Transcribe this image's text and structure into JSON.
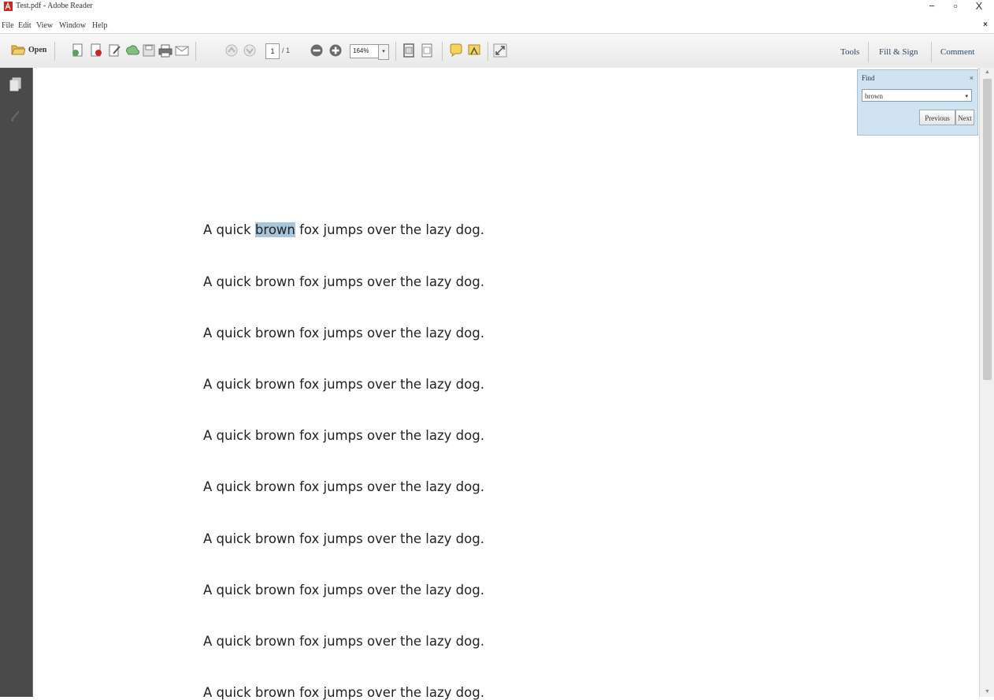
{
  "window": {
    "title": "Test.pdf - Adobe Reader",
    "minimize": "−",
    "maximize": "▫",
    "close": "X"
  },
  "menu": {
    "items": [
      "File",
      "Edit",
      "View",
      "Window",
      "Help"
    ],
    "close": "×"
  },
  "toolbar": {
    "open_label": "Open",
    "page_current": "1",
    "page_total": "/ 1",
    "zoom": "164%",
    "zoom_arrow": "▾"
  },
  "right_tabs": {
    "tools": "Tools",
    "fill_sign": "Fill & Sign",
    "comment": "Comment"
  },
  "find": {
    "title": "Find",
    "close": "×",
    "query": "brown",
    "dropdown": "▾",
    "previous": "Previous",
    "next": "Next"
  },
  "document": {
    "lines": [
      {
        "before": "A quick ",
        "highlight": "brown",
        "after": " fox jumps over the lazy dog."
      },
      {
        "text": "A quick brown fox jumps over the lazy dog."
      },
      {
        "text": "A quick brown fox jumps over the lazy dog."
      },
      {
        "text": "A quick brown fox jumps over the lazy dog."
      },
      {
        "text": "A quick brown fox jumps over the lazy dog."
      },
      {
        "text": "A quick brown fox jumps over the lazy dog."
      },
      {
        "text": "A quick brown fox jumps over the lazy dog."
      },
      {
        "text": "A quick brown fox jumps over the lazy dog."
      },
      {
        "text": "A quick brown fox jumps over the lazy dog."
      },
      {
        "text": "A quick brown fox jumps over the lazy dog."
      }
    ],
    "highlight_color": "#a8c5dc"
  },
  "scroll": {
    "up": "▲",
    "down": "▼"
  }
}
